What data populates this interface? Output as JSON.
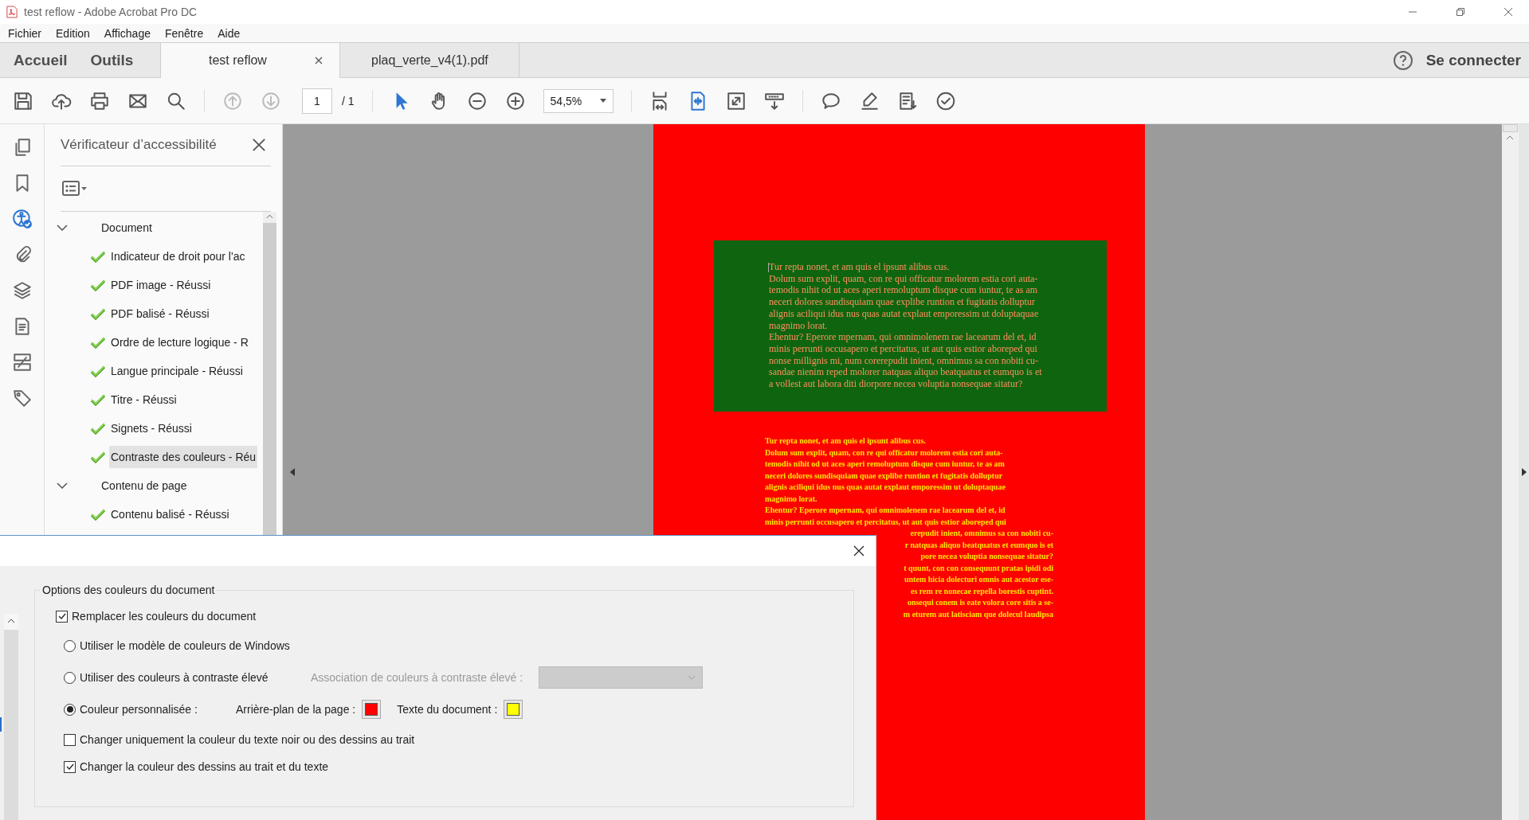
{
  "window": {
    "title": "test reflow - Adobe Acrobat Pro DC"
  },
  "menu": [
    "Fichier",
    "Edition",
    "Affichage",
    "Fenêtre",
    "Aide"
  ],
  "nav": [
    {
      "label": "Accueil"
    },
    {
      "label": "Outils"
    }
  ],
  "documents": [
    {
      "label": "test reflow",
      "selected": true
    },
    {
      "label": "plaq_verte_v4(1).pdf",
      "selected": false
    }
  ],
  "account": {
    "label": "Se connecter"
  },
  "toolbar": {
    "page_number": "1",
    "page_count": "/ 1",
    "zoom": "54,5%",
    "previous_disabled": true,
    "next_disabled": true
  },
  "rail": [
    {
      "selected": false
    },
    {
      "selected": false
    },
    {
      "selected": true
    },
    {
      "selected": false
    },
    {
      "selected": false
    },
    {
      "selected": false
    },
    {
      "selected": false
    },
    {
      "selected": false
    }
  ],
  "panel": {
    "title": "Vérificateur d’accessibilité",
    "tree": [
      {
        "label": "Document",
        "expanded": true,
        "children": [
          {
            "label": "Indicateur de droit pour l'ac",
            "passed": true,
            "selected": false
          },
          {
            "label": "PDF image - Réussi",
            "passed": true,
            "selected": false
          },
          {
            "label": "PDF balisé - Réussi",
            "passed": true,
            "selected": false
          },
          {
            "label": "Ordre de lecture logique - R",
            "passed": true,
            "selected": false
          },
          {
            "label": "Langue principale - Réussi",
            "passed": true,
            "selected": false
          },
          {
            "label": "Titre - Réussi",
            "passed": true,
            "selected": false
          },
          {
            "label": "Signets - Réussi",
            "passed": true,
            "selected": false
          },
          {
            "label": "Contraste des couleurs - Réu",
            "passed": true,
            "selected": true
          }
        ]
      },
      {
        "label": "Contenu de page",
        "expanded": true,
        "children": [
          {
            "label": "Contenu balisé - Réussi",
            "passed": true,
            "selected": false
          }
        ]
      }
    ]
  },
  "page": {
    "box_lines": [
      "Tur repta nonet, et am quis el ipsunt alibus cus.",
      "Dolum sum explit, quam, con re qui officatur molorem estia cori auta-",
      "temodis nihit od ut aces aperi remoluptum disque cum iuntur, te as am",
      "neceri dolores sundisquiam quae explibe runtion et fugitatis dolluptur",
      "alignis aciliqui idus nus quas autat explaut emporessim ut doluptaquae",
      "magnimo lorat.",
      "Ehentur? Eperore mpernam, qui omnimolenem rae lacearum del et, id",
      "minis perrunti occusapero et percitatus, ut aut quis estior aboreped qui",
      "nonse millignis mi, num corerepudit inient, omnimus sa con nobiti cu-",
      "sandae nienim reped molorer natquas aliquo beatquatus et eumquo is et",
      "a vollest aut labora diti diorpore necea voluptia nonsequae sitatur?"
    ],
    "lines": [
      "Tur repta nonet, et am quis el ipsunt alibus cus.",
      "Dolum sum explit, quam, con re qui officatur molorem estia cori auta-",
      "temodis nihit od ut aces aperi remoluptum disque cum iuntur, te as am",
      "neceri dolores sundisquiam quae explibe runtion et fugitatis dolluptur",
      "alignis aciliqui idus nus quas autat explaut emporessim ut doluptaquae",
      "magnimo lorat.",
      "Ehentur? Eperore mpernam, qui omnimolenem rae lacearum del et, id",
      "minis perrunti occusapero et percitatus, ut aut quis estior aboreped qui"
    ],
    "lines_beside_dialog": [
      "erepudit inient, omnimus sa con nobiti cu-",
      "r natquas aliquo beatquatus et eumquo is et",
      "pore necea voluptia nonsequae sitatur?",
      "t quunt, con con consequunt pratas ipidi odi",
      "untem hicia dolecturi omnis aut acestor ese-",
      "es rem re nonecae repella borestis cuptint.",
      "onsequi conem is eate volora core sitis a se-",
      "m eturem aut latisciam que dolecul laudipsa"
    ]
  },
  "dialog": {
    "group_title": "Options des couleurs du document",
    "replace_colors": {
      "label": "Remplacer les couleurs du document",
      "checked": true
    },
    "options": [
      {
        "kind": "radio",
        "label": "Utiliser le modèle de couleurs de Windows",
        "selected": false
      },
      {
        "kind": "radio",
        "label": "Utiliser des couleurs à contraste élevé",
        "selected": false,
        "scheme": {
          "label": "Association de couleurs à contraste élevé :",
          "disabled": true
        }
      },
      {
        "kind": "radio",
        "label": "Couleur personnalisée :",
        "selected": true,
        "swatches": [
          {
            "label": "Arrière-plan de la page :",
            "color": "#ff0000"
          },
          {
            "label": "Texte du document :",
            "color": "#ffff00"
          }
        ]
      },
      {
        "kind": "checkbox",
        "label": "Changer uniquement la couleur du texte noir ou des dessins au trait",
        "checked": false
      },
      {
        "kind": "checkbox",
        "label": "Changer la couleur des dessins au trait et du texte",
        "checked": true
      }
    ]
  }
}
